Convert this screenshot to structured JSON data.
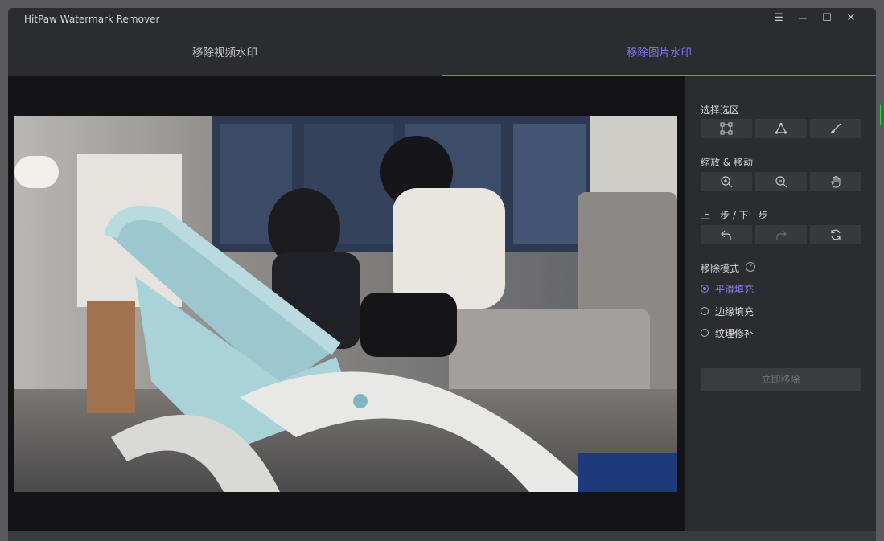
{
  "app": {
    "title": "HitPaw Watermark Remover"
  },
  "window_controls": {
    "menu": "☰",
    "minimize": "—",
    "maximize": "☐",
    "close": "✕"
  },
  "tabs": [
    {
      "label": "移除视频水印",
      "active": false
    },
    {
      "label": "移除图片水印",
      "active": true
    }
  ],
  "panel": {
    "select_area": {
      "label": "选择选区",
      "tools": [
        "rect-select-icon",
        "polygon-select-icon",
        "brush-icon"
      ]
    },
    "zoom_move": {
      "label": "缩放 & 移动",
      "tools": [
        "zoom-in-icon",
        "zoom-out-icon",
        "hand-icon"
      ]
    },
    "undo_redo": {
      "label": "上一步 / 下一步",
      "tools": [
        "undo-icon",
        "redo-icon",
        "reset-icon"
      ]
    },
    "mode": {
      "label": "移除模式",
      "help": "?",
      "options": [
        {
          "label": "平滑填充",
          "selected": true
        },
        {
          "label": "边缘填充",
          "selected": false
        },
        {
          "label": "纹理修补",
          "selected": false
        }
      ]
    },
    "remove_button": "立即移除"
  },
  "colors": {
    "accent": "#7e73f0",
    "panel_bg": "#2b2c2f",
    "canvas_bg": "#141416"
  }
}
